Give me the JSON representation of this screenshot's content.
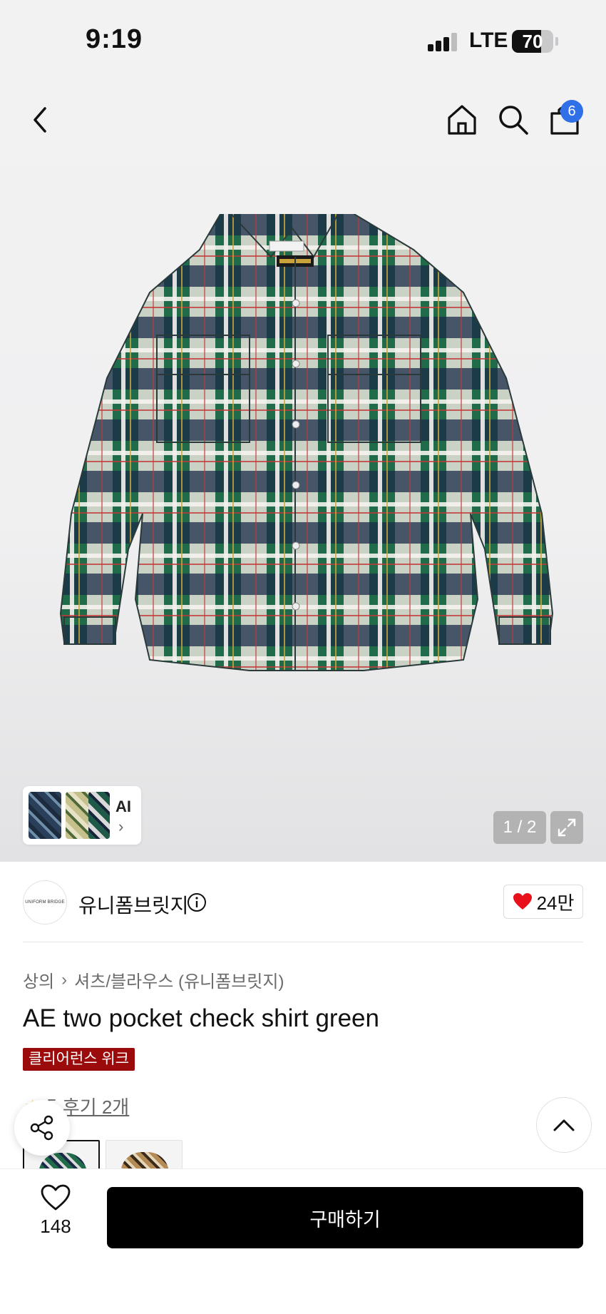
{
  "status_bar": {
    "time": "9:19",
    "network": "LTE",
    "battery": "70",
    "battery_level": 0.7
  },
  "nav": {
    "cart_count": "6"
  },
  "gallery": {
    "ai_label": "AI",
    "counter": "1 / 2"
  },
  "brand": {
    "logo_text": "UNIFORM BRIDGE",
    "name": "유니폼브릿지",
    "likes": "24만"
  },
  "breadcrumb": {
    "category": "상의",
    "subcategory": "셔츠/블라우스 (유니폼브릿지)"
  },
  "product": {
    "title": "AE two pocket check shirt green",
    "promo_badge": "클리어런스 위크"
  },
  "rating": {
    "score": "5",
    "reviews": "후기 2개"
  },
  "bottom_bar": {
    "wish_count": "148",
    "buy_label": "구매하기"
  },
  "colors": {
    "accent": "#2f6fe8",
    "promo": "#9b0b0b",
    "heart": "#e8101a",
    "primary_button": "#000000"
  },
  "icons": [
    "back-icon",
    "home-icon",
    "search-icon",
    "shopping-bag-icon",
    "info-icon",
    "heart-icon",
    "share-icon",
    "chevron-up-icon",
    "expand-icon"
  ]
}
